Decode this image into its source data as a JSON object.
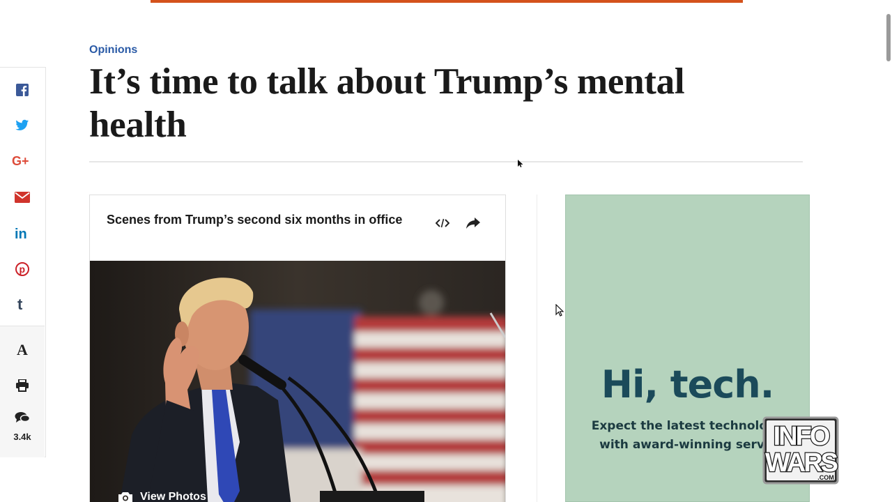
{
  "page": {
    "section": "Opinions",
    "headline": "It’s time to talk about Trump’s mental health"
  },
  "share_rail": {
    "items": [
      {
        "icon": "facebook-icon",
        "color": "#3b5998"
      },
      {
        "icon": "twitter-icon",
        "color": "#1da1f2"
      },
      {
        "icon": "google-plus-icon",
        "color": "#dd4b39"
      },
      {
        "icon": "email-icon",
        "color": "#d0342c"
      },
      {
        "icon": "linkedin-icon",
        "color": "#0077b5"
      },
      {
        "icon": "pinterest-icon",
        "color": "#cb2027"
      },
      {
        "icon": "tumblr-icon",
        "color": "#35465c"
      }
    ],
    "tools": [
      {
        "icon": "font-size-icon",
        "label": "A"
      },
      {
        "icon": "print-icon"
      },
      {
        "icon": "comments-icon"
      }
    ],
    "comment_count": "3.4k"
  },
  "gallery": {
    "title": "Scenes from Trump’s second six months in office",
    "view_photos_label": "View Photos",
    "embed_icon": "embed-code-icon",
    "share_icon": "share-arrow-icon"
  },
  "ad": {
    "headline": "Hi, tech.",
    "body_line1": "Expect the latest technology",
    "body_line2": "with award-winning servic",
    "background": "#b5d3bd"
  },
  "watermark": {
    "text_top": "INFO",
    "text_bottom": "WARS",
    "suffix": ".COM"
  },
  "colors": {
    "accent_bar": "#d4521c",
    "section_link": "#2a5aa6"
  }
}
